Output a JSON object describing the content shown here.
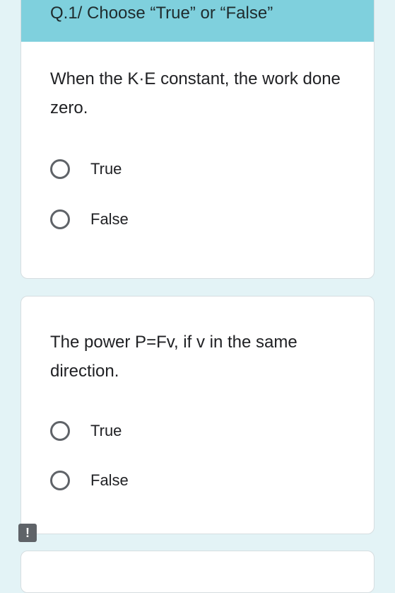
{
  "section": {
    "title": "Q.1/ Choose “True” or “False”"
  },
  "questions": [
    {
      "text": "When the K·E constant, the work done zero.",
      "options": [
        {
          "label": "True"
        },
        {
          "label": "False"
        }
      ]
    },
    {
      "text": "The power P=Fv, if v in the same direction.",
      "options": [
        {
          "label": "True"
        },
        {
          "label": "False"
        }
      ]
    }
  ],
  "feedback_icon": {
    "symbol": "!",
    "icon": "report-problem-icon"
  },
  "colors": {
    "page_background": "#e3f3f6",
    "header_background": "#7fd0dd",
    "radio_border": "#5f6368"
  }
}
